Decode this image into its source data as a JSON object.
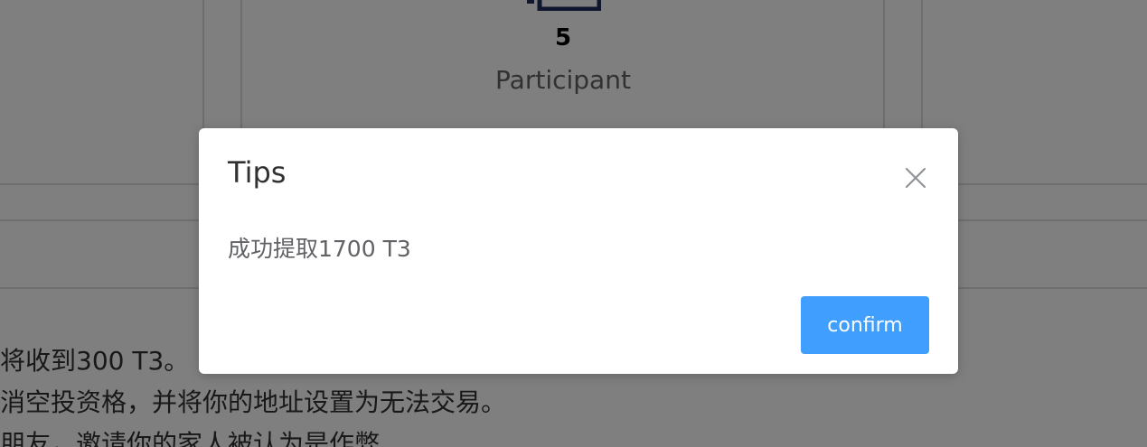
{
  "stats": {
    "value": "5",
    "label": "Participant",
    "icon": "participant-icon"
  },
  "rules": {
    "lines": [
      "将收到300 T3。",
      "消空投资格，并将你的地址设置为无法交易。",
      "朋友，邀请你的家人被认为是作弊"
    ]
  },
  "dialog": {
    "title": "Tips",
    "message": "成功提取1700 T3",
    "confirm_label": "confirm",
    "close_icon": "close-icon"
  },
  "colors": {
    "primary": "#409eff",
    "overlay": "rgba(0,0,0,0.5)"
  }
}
